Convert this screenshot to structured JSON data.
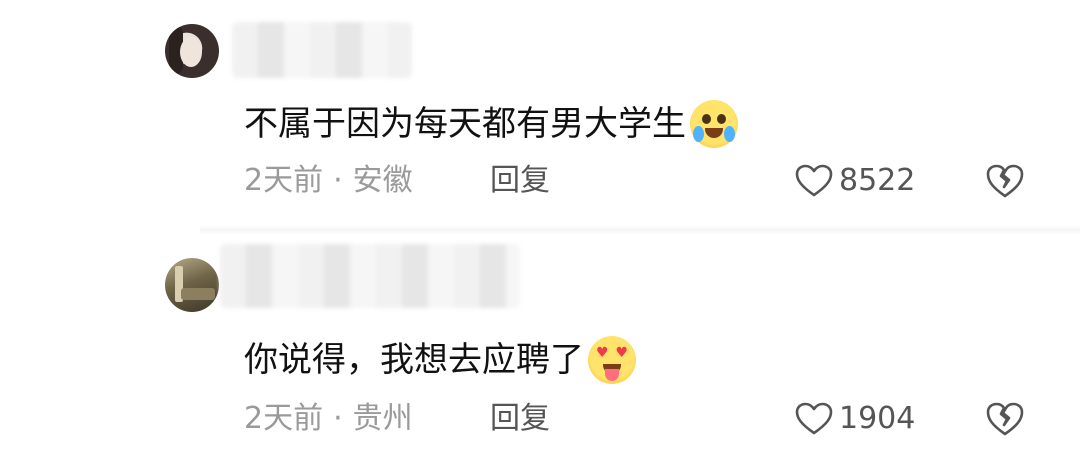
{
  "comments": [
    {
      "text": "不属于因为每天都有男大学生",
      "emoji": "laughing-crying-emoji",
      "time": "2天前",
      "location": "安徽",
      "reply_label": "回复",
      "likes": "8522"
    },
    {
      "text": "你说得，我想去应聘了",
      "emoji": "heart-eyes-tongue-emoji",
      "time": "2天前",
      "location": "贵州",
      "reply_label": "回复",
      "likes": "1904"
    }
  ],
  "separator": "·",
  "icons": {
    "like": "heart-outline-icon",
    "dislike": "broken-heart-icon"
  },
  "colors": {
    "text": "#111111",
    "meta": "#9a9a9a",
    "action": "#555555"
  }
}
